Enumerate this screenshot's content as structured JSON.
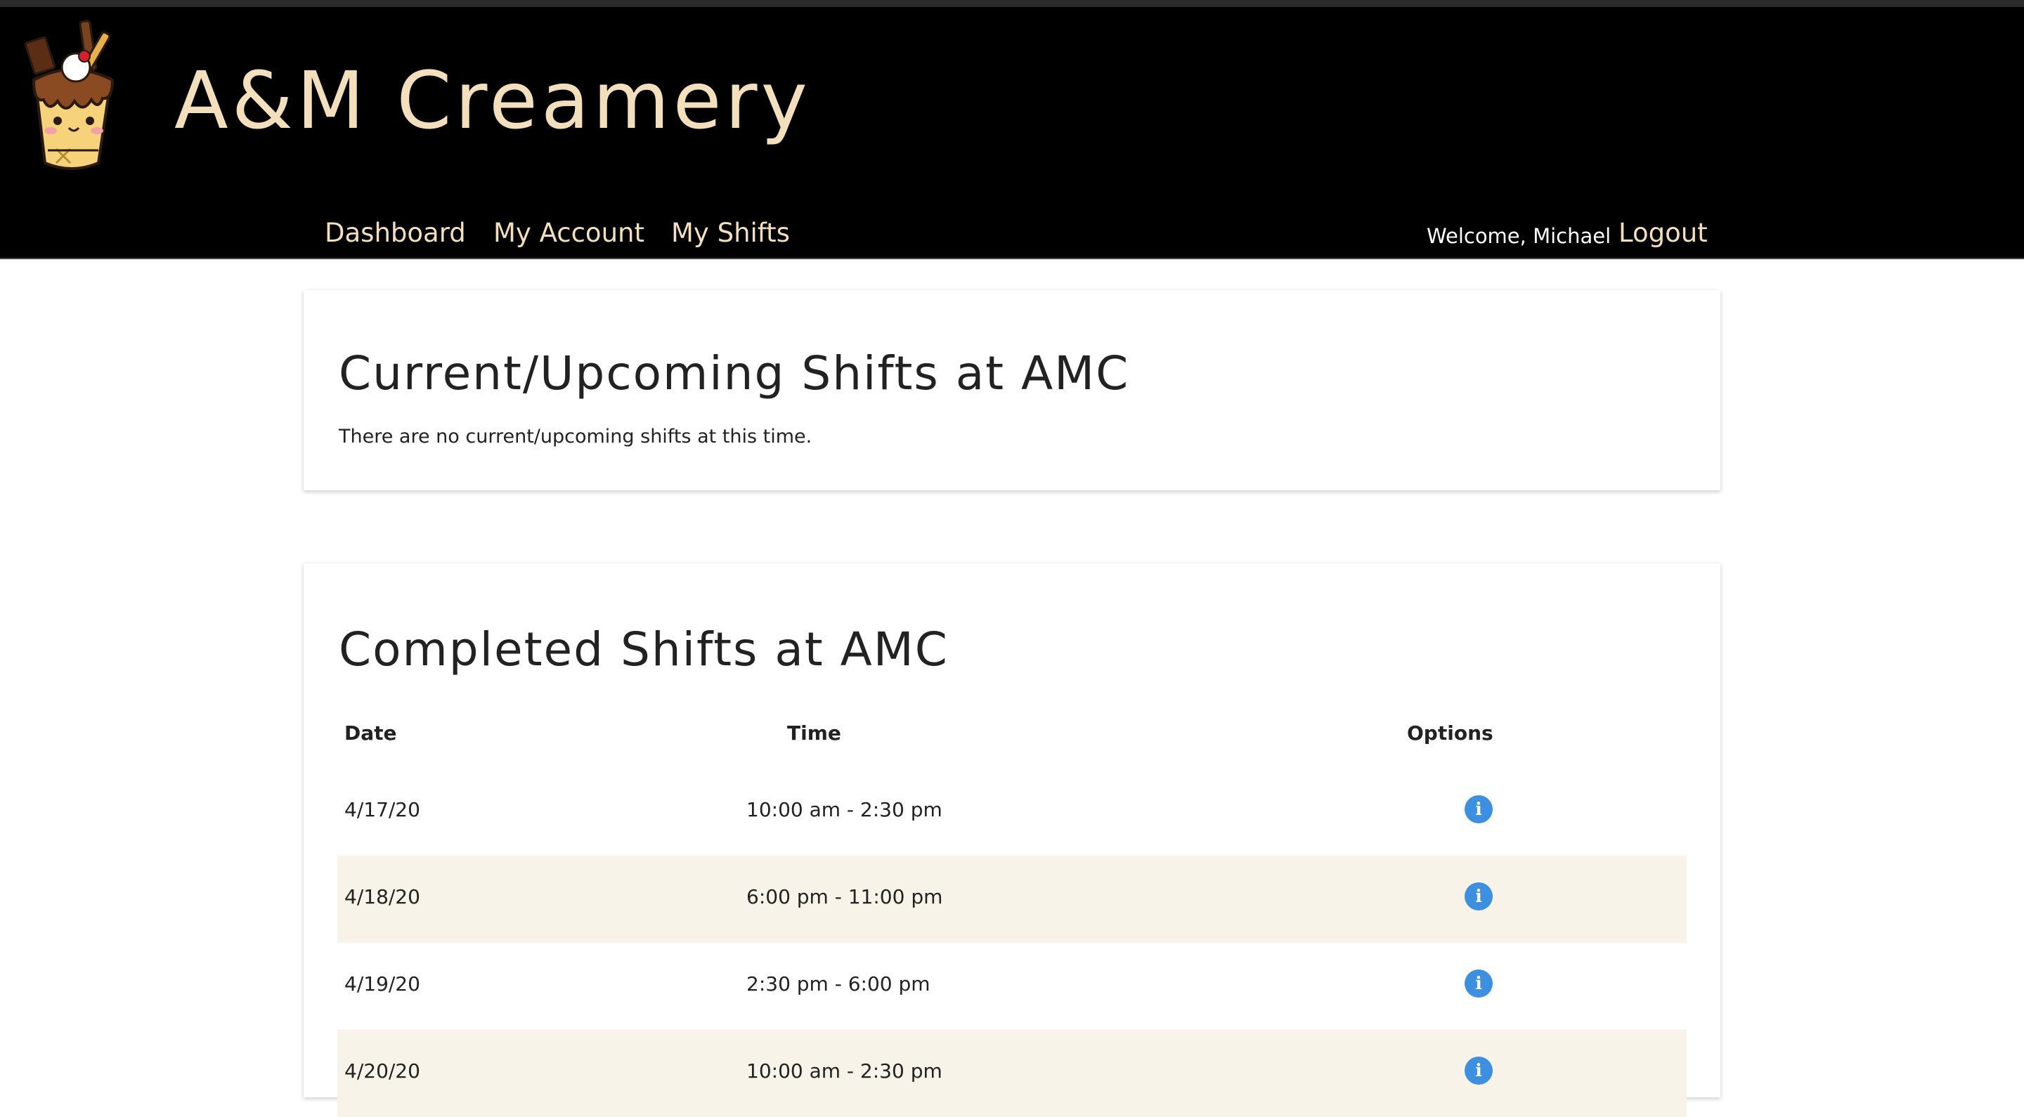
{
  "brand": {
    "name": "A&M Creamery"
  },
  "nav": {
    "dashboard": "Dashboard",
    "my_account": "My Account",
    "my_shifts": "My Shifts",
    "welcome": "Welcome, Michael",
    "logout": "Logout"
  },
  "current": {
    "title": "Current/Upcoming Shifts at AMC",
    "empty_message": "There are no current/upcoming shifts at this time."
  },
  "completed": {
    "title": "Completed Shifts at AMC",
    "columns": [
      "Date",
      "Time",
      "Options"
    ],
    "rows": [
      {
        "date": "4/17/20",
        "time": "10:00 am - 2:30 pm"
      },
      {
        "date": "4/18/20",
        "time": "6:00 pm - 11:00 pm"
      },
      {
        "date": "4/19/20",
        "time": "2:30 pm - 6:00 pm"
      },
      {
        "date": "4/20/20",
        "time": "10:00 am - 2:30 pm"
      }
    ],
    "info_icon_glyph": "i"
  },
  "colors": {
    "header_bg": "#000000",
    "brand_text": "#f3dfbb",
    "row_stripe": "#f8f3e8",
    "info_icon": "#3d8fe0"
  },
  "icons": {
    "logo": "ice-cream-sundae-logo",
    "row_option": "info-circle-icon"
  }
}
